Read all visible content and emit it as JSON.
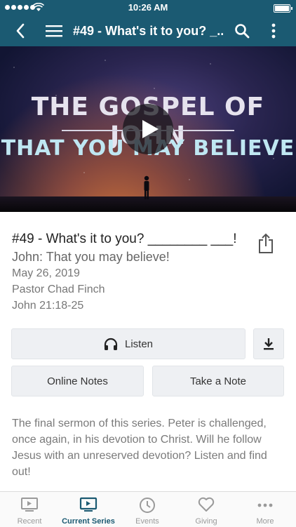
{
  "status_bar": {
    "time": "10:26 AM"
  },
  "nav": {
    "title": "#49 - What's it to you? _...",
    "back_icon": "chevron-left-icon",
    "menu_icon": "hamburger-icon",
    "search_icon": "search-icon",
    "more_icon": "more-vertical-icon"
  },
  "hero": {
    "line1": "THE GOSPEL OF JOHN",
    "line2": "THAT YOU MAY BELIEVE",
    "play_icon": "play-icon"
  },
  "sermon": {
    "title": "#49 - What's it to you? ________ ___!",
    "series": "John: That you may believe!",
    "date": "May 26, 2019",
    "speaker": "Pastor Chad Finch",
    "scripture": "John 21:18-25",
    "description": "The final sermon of this series. Peter is challenged, once again, in his devotion to Christ. Will he follow Jesus with an unreserved devotion? Listen and find out!"
  },
  "actions": {
    "listen_label": "Listen",
    "online_notes_label": "Online Notes",
    "take_note_label": "Take a Note",
    "download_icon": "download-icon",
    "share_icon": "share-icon",
    "headphones_icon": "headphones-icon"
  },
  "tabs": [
    {
      "label": "Recent",
      "icon": "play-screen-icon",
      "active": false
    },
    {
      "label": "Current Series",
      "icon": "play-screen-icon",
      "active": true
    },
    {
      "label": "Events",
      "icon": "clock-icon",
      "active": false
    },
    {
      "label": "Giving",
      "icon": "heart-icon",
      "active": false
    },
    {
      "label": "More",
      "icon": "ellipsis-icon",
      "active": false
    }
  ],
  "colors": {
    "brand": "#1b5a72",
    "button_bg": "#eef0f3",
    "tab_inactive": "#9a9a9a"
  }
}
